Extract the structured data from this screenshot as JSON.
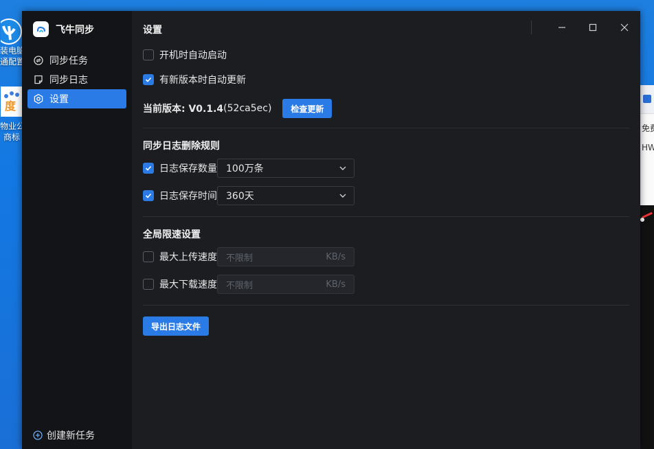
{
  "desktop": {
    "icon1_label_line1": "装电脑",
    "icon1_label_line2": "通配置",
    "icon2_label_line1": "物业公",
    "icon2_label_line2": "商标",
    "peek_text_1": "免费",
    "peek_text_2": "HWI"
  },
  "app": {
    "name": "飞牛同步",
    "accent": "#2b7be6"
  },
  "sidebar": {
    "items": [
      {
        "label": "同步任务",
        "icon": "sync-icon"
      },
      {
        "label": "同步日志",
        "icon": "log-icon"
      },
      {
        "label": "设置",
        "icon": "gear-icon",
        "active": true
      }
    ],
    "create_task": "创建新任务"
  },
  "settings": {
    "title": "设置",
    "autostart_label": "开机时自动启动",
    "autostart_checked": false,
    "autoupdate_label": "有新版本时自动更新",
    "autoupdate_checked": true,
    "version_label": "当前版本: V0.1.4",
    "version_hash": "(52ca5ec)",
    "check_update_button": "检查更新",
    "log_rule_title": "同步日志删除规则",
    "log_count_label": "日志保存数量",
    "log_count_checked": true,
    "log_count_value": "100万条",
    "log_time_label": "日志保存时间",
    "log_time_checked": true,
    "log_time_value": "360天",
    "speed_title": "全局限速设置",
    "upload_label": "最大上传速度",
    "upload_checked": false,
    "upload_placeholder": "不限制",
    "upload_unit": "KB/s",
    "download_label": "最大下载速度",
    "download_checked": false,
    "download_placeholder": "不限制",
    "download_unit": "KB/s",
    "export_button": "导出日志文件"
  }
}
